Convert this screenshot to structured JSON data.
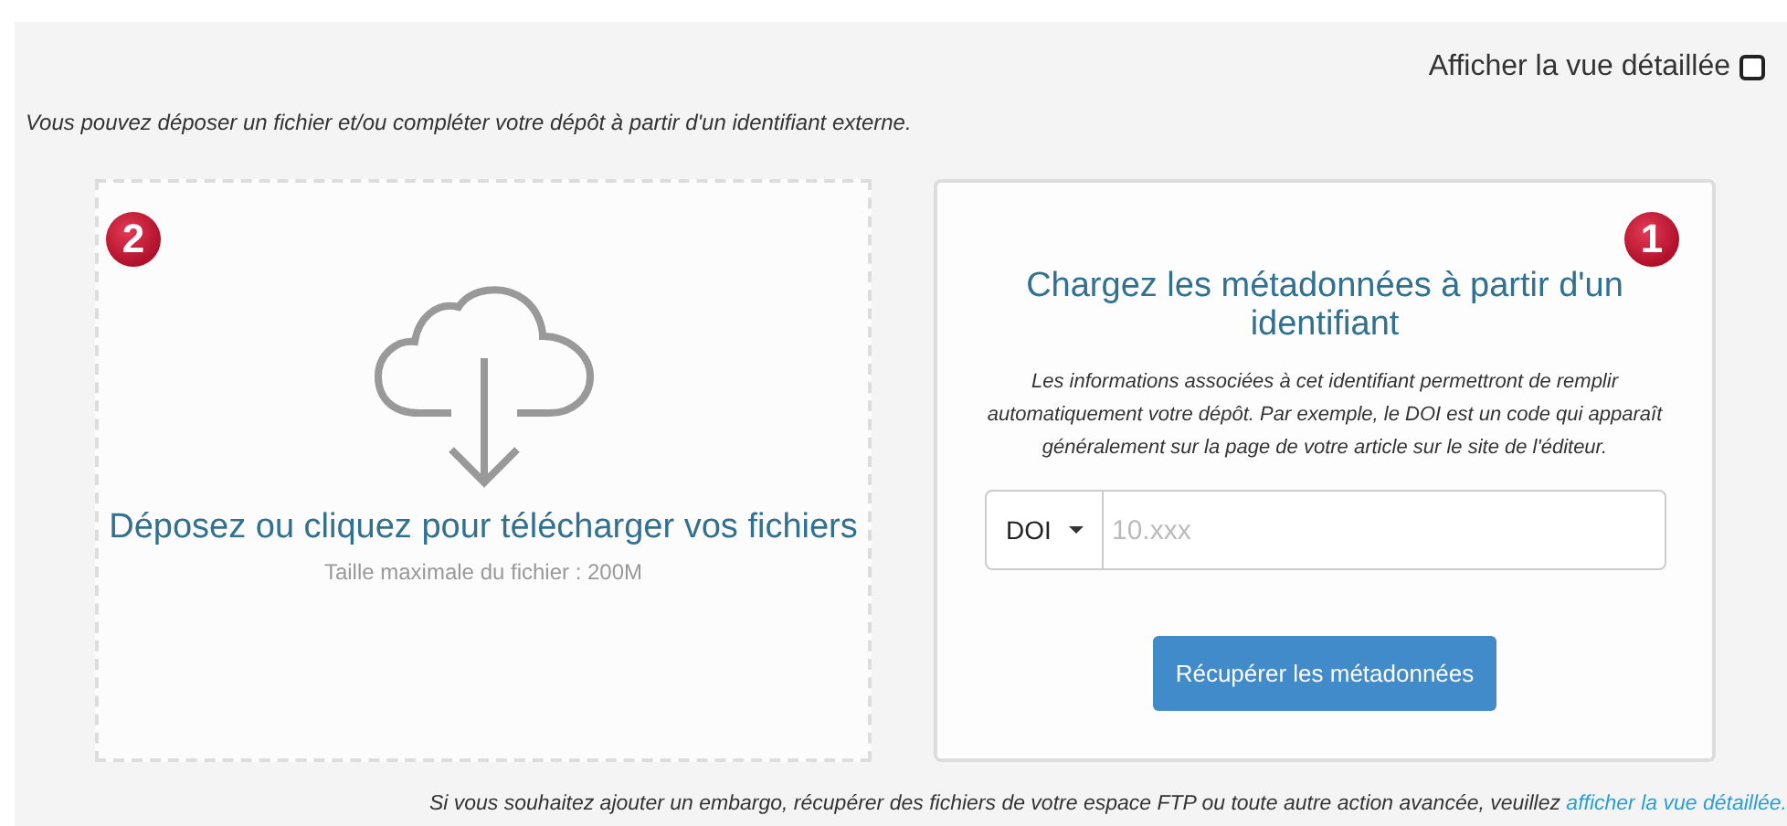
{
  "detail_toggle": {
    "label": "Afficher la vue détaillée",
    "checked": false
  },
  "intro": "Vous pouvez déposer un fichier et/ou compléter votre dépôt à partir d'un identifiant externe.",
  "dropzone": {
    "badge": "2",
    "title": "Déposez ou cliquez pour télécharger vos fichiers",
    "hint": "Taille maximale du fichier : 200M"
  },
  "metadata_card": {
    "badge": "1",
    "title": "Chargez les métadonnées à partir d'un identifiant",
    "description": "Les informations associées à cet identifiant permettront de remplir automatiquement votre dépôt. Par exemple, le DOI est un code qui apparaît généralement sur la page de votre article sur le site de l'éditeur.",
    "id_type": "DOI",
    "placeholder": "10.xxx",
    "button": "Récupérer les métadonnées"
  },
  "footer": {
    "text": "Si vous souhaitez ajouter un embargo, récupérer des fichiers de votre espace FTP ou toute autre action avancée, veuillez ",
    "link": "afficher la vue détaillée."
  }
}
